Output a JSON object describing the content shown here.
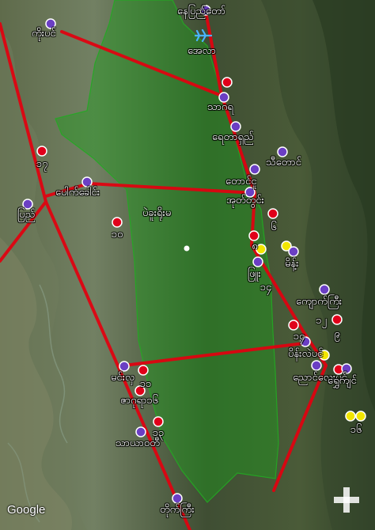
{
  "colors": {
    "route": "#e3000f",
    "protected_area_fill": "#1aa01a",
    "marker_purple": "#6b3fc4",
    "marker_red": "#e0001a",
    "marker_yellow": "#f2e600",
    "label_text": "#ffffff"
  },
  "attribution": "Google",
  "controls": {
    "zoom_in_icon": "plus-icon",
    "airport_icon": "airplane-icon"
  },
  "places": [
    {
      "id": "naypyitaw",
      "label": "နေပြည်တော်",
      "marker": "purple"
    },
    {
      "id": "kobin",
      "label": "ကိုးပင်",
      "marker": "purple"
    },
    {
      "id": "ela",
      "label": "အေလာ",
      "marker": "purple"
    },
    {
      "id": "sagaria",
      "label": "သာဂရ",
      "marker": "purple"
    },
    {
      "id": "yedashe",
      "label": "ရေတာရှည်",
      "marker": "purple"
    },
    {
      "id": "thitaung",
      "label": "သီတောင်",
      "marker": "purple"
    },
    {
      "id": "taungoo",
      "label": "တောင်ငူ",
      "marker": "purple"
    },
    {
      "id": "okhtwin",
      "label": "အုတ်တွင်း",
      "marker": "purple"
    },
    {
      "id": "paukkhaung",
      "label": "ပေါက်ခေါင်း",
      "marker": "purple"
    },
    {
      "id": "pyay",
      "label": "ပြည်",
      "marker": "purple"
    },
    {
      "id": "bago-yoma",
      "label": "ပဲခူးရိုးမ",
      "marker": "none"
    },
    {
      "id": "min-nae",
      "label": "မိန့်း",
      "marker": "purple"
    },
    {
      "id": "phyu",
      "label": "ဖြူး",
      "marker": "purple"
    },
    {
      "id": "kyaukkyi",
      "label": "ကျောက်ကြီး",
      "marker": "purple"
    },
    {
      "id": "painglaypin",
      "label": "ပိန်းလဲပင်",
      "marker": "purple"
    },
    {
      "id": "nyaunglebin",
      "label": "ညောင်လေးပင်",
      "marker": "purple"
    },
    {
      "id": "shwegyin",
      "label": "ရွှေကျင်",
      "marker": "purple"
    },
    {
      "id": "minhla",
      "label": "မင်းလှ",
      "marker": "purple"
    },
    {
      "id": "okpho",
      "label": "ဇာဂုရာ၁၆",
      "marker": "red"
    },
    {
      "id": "tharyarwaddy",
      "label": "သာယာဝတီ",
      "marker": "purple"
    },
    {
      "id": "taikkyi",
      "label": "တိုက်ကြီး",
      "marker": "purple"
    }
  ],
  "incident_labels": [
    "၁၇",
    "၁၀",
    "၆",
    "၁၄",
    "၁၄",
    "၁၂",
    "၉",
    "၁၁",
    "၁၃",
    "၁၆",
    "၈"
  ]
}
